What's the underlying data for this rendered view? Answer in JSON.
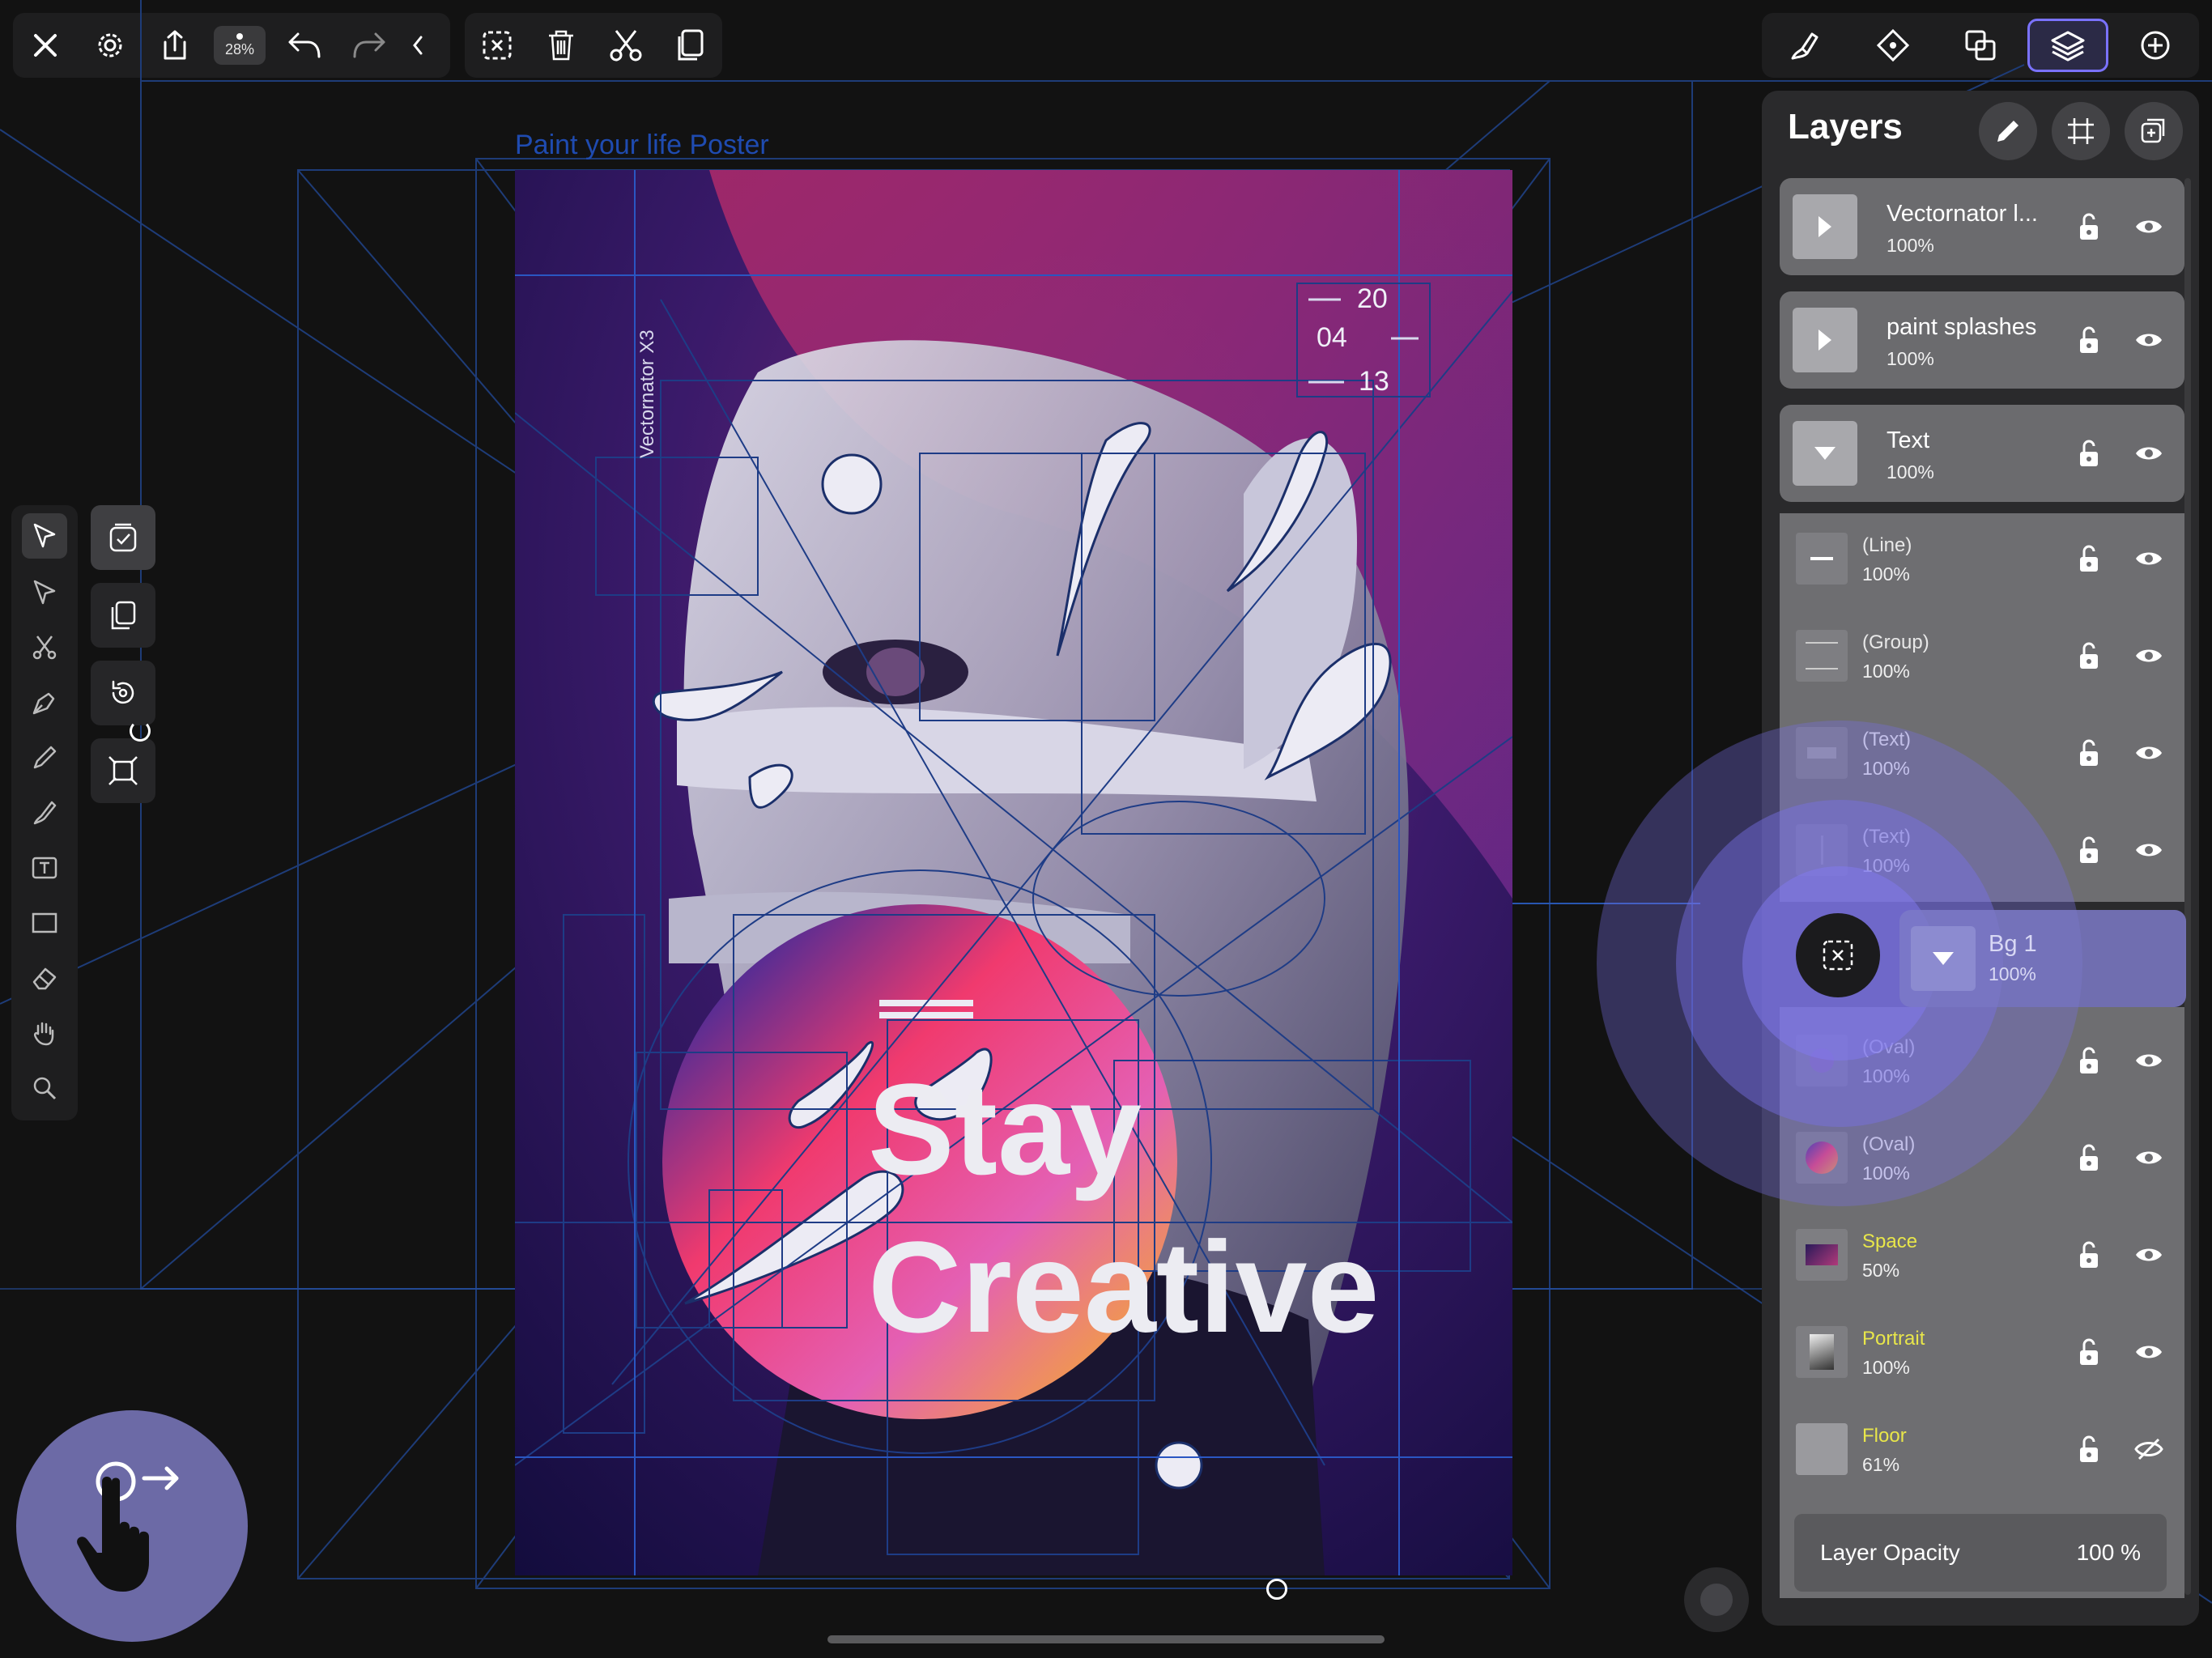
{
  "top_toolbar": {
    "zoom_label": "28%"
  },
  "canvas": {
    "artboard_name": "Paint your life Poster"
  },
  "poster": {
    "vertical_label": "Vectornator X3",
    "date_top": "20",
    "date_mid": "04",
    "date_bottom": "13",
    "headline_line1": "Stay",
    "headline_line2": "Creative"
  },
  "layers_panel": {
    "title": "Layers",
    "top_layers": [
      {
        "name": "Vectornator l...",
        "opacity": "100%"
      },
      {
        "name": "paint splashes",
        "opacity": "100%"
      },
      {
        "name": "Text",
        "opacity": "100%"
      }
    ],
    "sublayers": [
      {
        "name": "(Line)",
        "opacity": "100%"
      },
      {
        "name": "(Group)",
        "opacity": "100%"
      },
      {
        "name": "(Text)",
        "opacity": "100%"
      },
      {
        "name": "(Text)",
        "opacity": "100%"
      }
    ],
    "dragged_layer": {
      "name": "Bg 1",
      "opacity": "100%"
    },
    "bg_sublayers": [
      {
        "name": "(Oval)",
        "opacity": "100%"
      },
      {
        "name": "(Oval)",
        "opacity": "100%"
      },
      {
        "name": "Space",
        "opacity": "50%"
      },
      {
        "name": "Portrait",
        "opacity": "100%"
      },
      {
        "name": "Floor",
        "opacity": "61%"
      }
    ],
    "opacity_label": "Layer Opacity",
    "opacity_value": "100 %"
  },
  "colors": {
    "accent": "#7a72ff",
    "yellow_label": "#e8e64a",
    "panel_bg": "#2a2a2c"
  }
}
